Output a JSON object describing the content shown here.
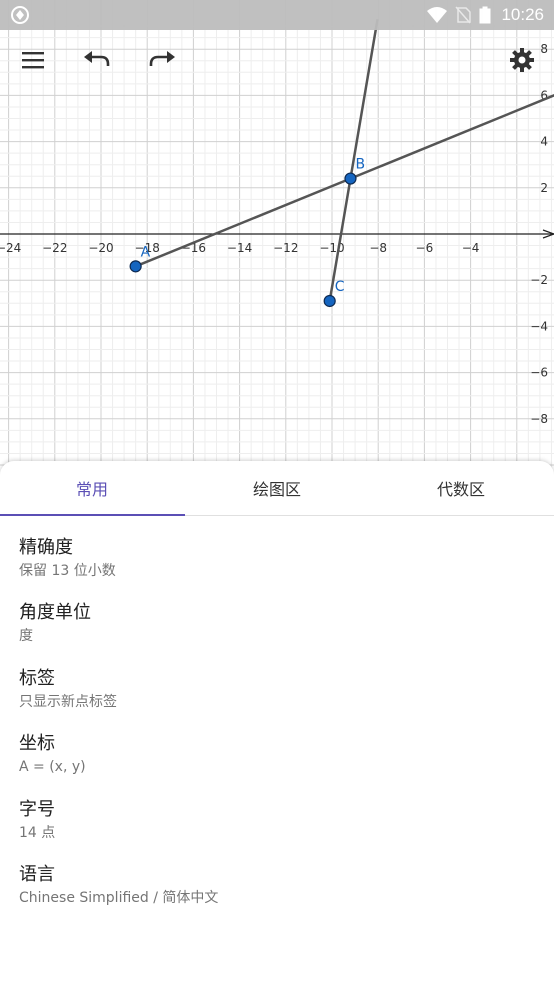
{
  "status_bar": {
    "time": "10:26",
    "icons": [
      "app-icon",
      "wifi-icon",
      "no-sim-icon",
      "battery-icon"
    ]
  },
  "toolbar": {
    "icons": [
      "menu-icon",
      "undo-icon",
      "redo-icon",
      "settings-icon"
    ]
  },
  "graph": {
    "x_range": [
      -25.5,
      4
    ],
    "y_range": [
      -10,
      8.3
    ],
    "x_ticks": [
      -24,
      -22,
      -20,
      -18,
      -16,
      -14,
      -12,
      -10,
      -8,
      -6,
      -4
    ],
    "y_ticks": [
      -8,
      -6,
      -4,
      -2,
      2,
      4,
      6,
      8
    ],
    "grid": true,
    "points": [
      {
        "name": "A",
        "x": -18.5,
        "y": -1.4
      },
      {
        "name": "B",
        "x": -9.2,
        "y": 2.4
      },
      {
        "name": "C",
        "x": -10.1,
        "y": -2.9
      }
    ],
    "line_color": "#555555",
    "point_color": "#1565c0"
  },
  "tabs": [
    {
      "label": "常用",
      "active": true
    },
    {
      "label": "绘图区",
      "active": false
    },
    {
      "label": "代数区",
      "active": false
    }
  ],
  "accent_color": "#5b4fb5",
  "preferences": [
    {
      "title": "精确度",
      "value": "保留 13 位小数"
    },
    {
      "title": "角度单位",
      "value": "度"
    },
    {
      "title": "标签",
      "value": "只显示新点标签"
    },
    {
      "title": "坐标",
      "value": "A = (x, y)"
    },
    {
      "title": "字号",
      "value": "14 点"
    },
    {
      "title": "语言",
      "value": "Chinese Simplified / 简体中文"
    }
  ]
}
